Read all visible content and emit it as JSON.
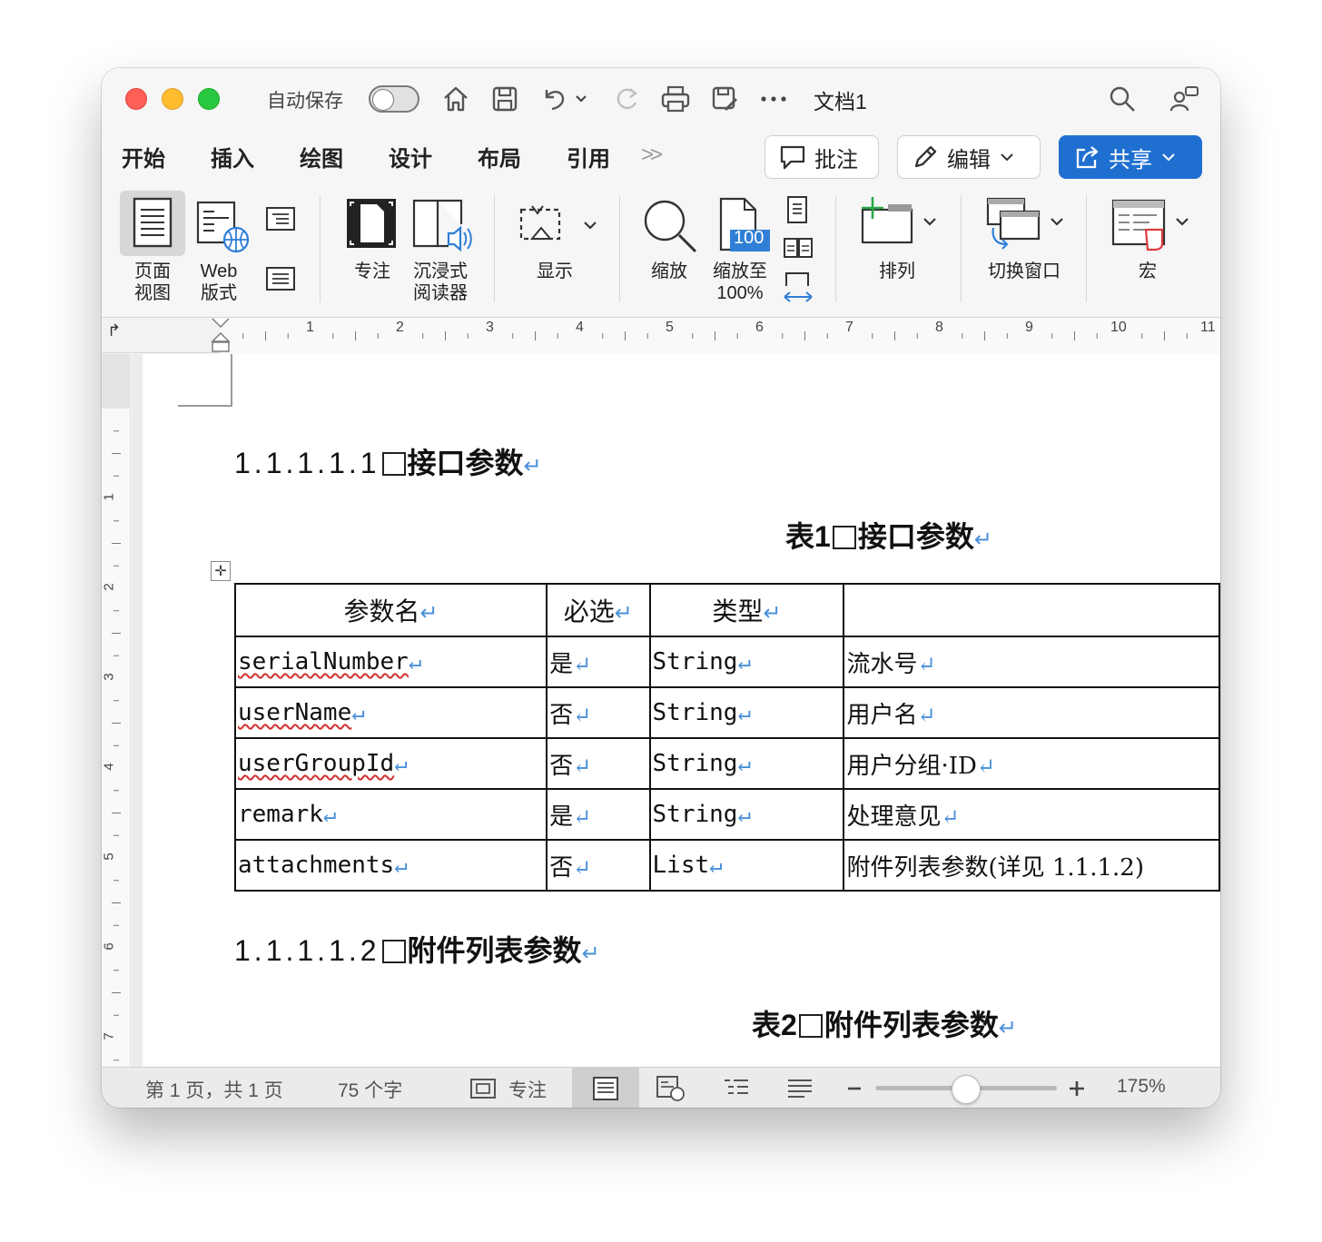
{
  "titlebar": {
    "autosave_label": "自动保存",
    "doc_title": "文档1"
  },
  "tabs": [
    "开始",
    "插入",
    "绘图",
    "设计",
    "布局",
    "引用"
  ],
  "tab_more": ">>",
  "actions": {
    "comment": "批注",
    "edit": "编辑",
    "share": "共享"
  },
  "ribbon": {
    "page_view": [
      "页面",
      "视图"
    ],
    "web_view": [
      "Web",
      "版式"
    ],
    "focus": "专注",
    "immersive": [
      "沉浸式",
      "阅读器"
    ],
    "show": "显示",
    "zoom": "缩放",
    "zoom100": [
      "缩放至",
      "100%"
    ],
    "zoom100_badge": "100",
    "arrange": "排列",
    "switch_window": "切换窗口",
    "macro": "宏"
  },
  "ruler": {
    "h_numbers": [
      "1",
      "2",
      "3",
      "4",
      "5",
      "6",
      "7",
      "8",
      "9",
      "10",
      "11"
    ],
    "v_numbers": [
      "1",
      "2",
      "3",
      "4",
      "5",
      "6",
      "7"
    ]
  },
  "document": {
    "heading1_num": "1.1.1.1.1",
    "heading1_text": "接口参数",
    "caption1_prefix": "表1",
    "caption1_text": "接口参数",
    "table": {
      "headers": [
        "参数名",
        "必选",
        "类型",
        ""
      ],
      "rows": [
        [
          "serialNumber",
          "是",
          "String",
          "流水号"
        ],
        [
          "userName",
          "否",
          "String",
          "用户名"
        ],
        [
          "userGroupId",
          "否",
          "String",
          "用户分组·ID"
        ],
        [
          "remark",
          "是",
          "String",
          "处理意见"
        ],
        [
          "attachments",
          "否",
          "List",
          "附件列表参数(详见 1.1.1.2)"
        ]
      ]
    },
    "heading2_num": "1.1.1.1.2",
    "heading2_text": "附件列表参数",
    "caption2_prefix": "表2",
    "caption2_text": "附件列表参数",
    "return_mark": "↵"
  },
  "statusbar": {
    "page_info": "第 1 页，共 1 页",
    "word_count": "75 个字",
    "focus": "专注",
    "zoom": "175%",
    "zoom_level": 0.5
  }
}
